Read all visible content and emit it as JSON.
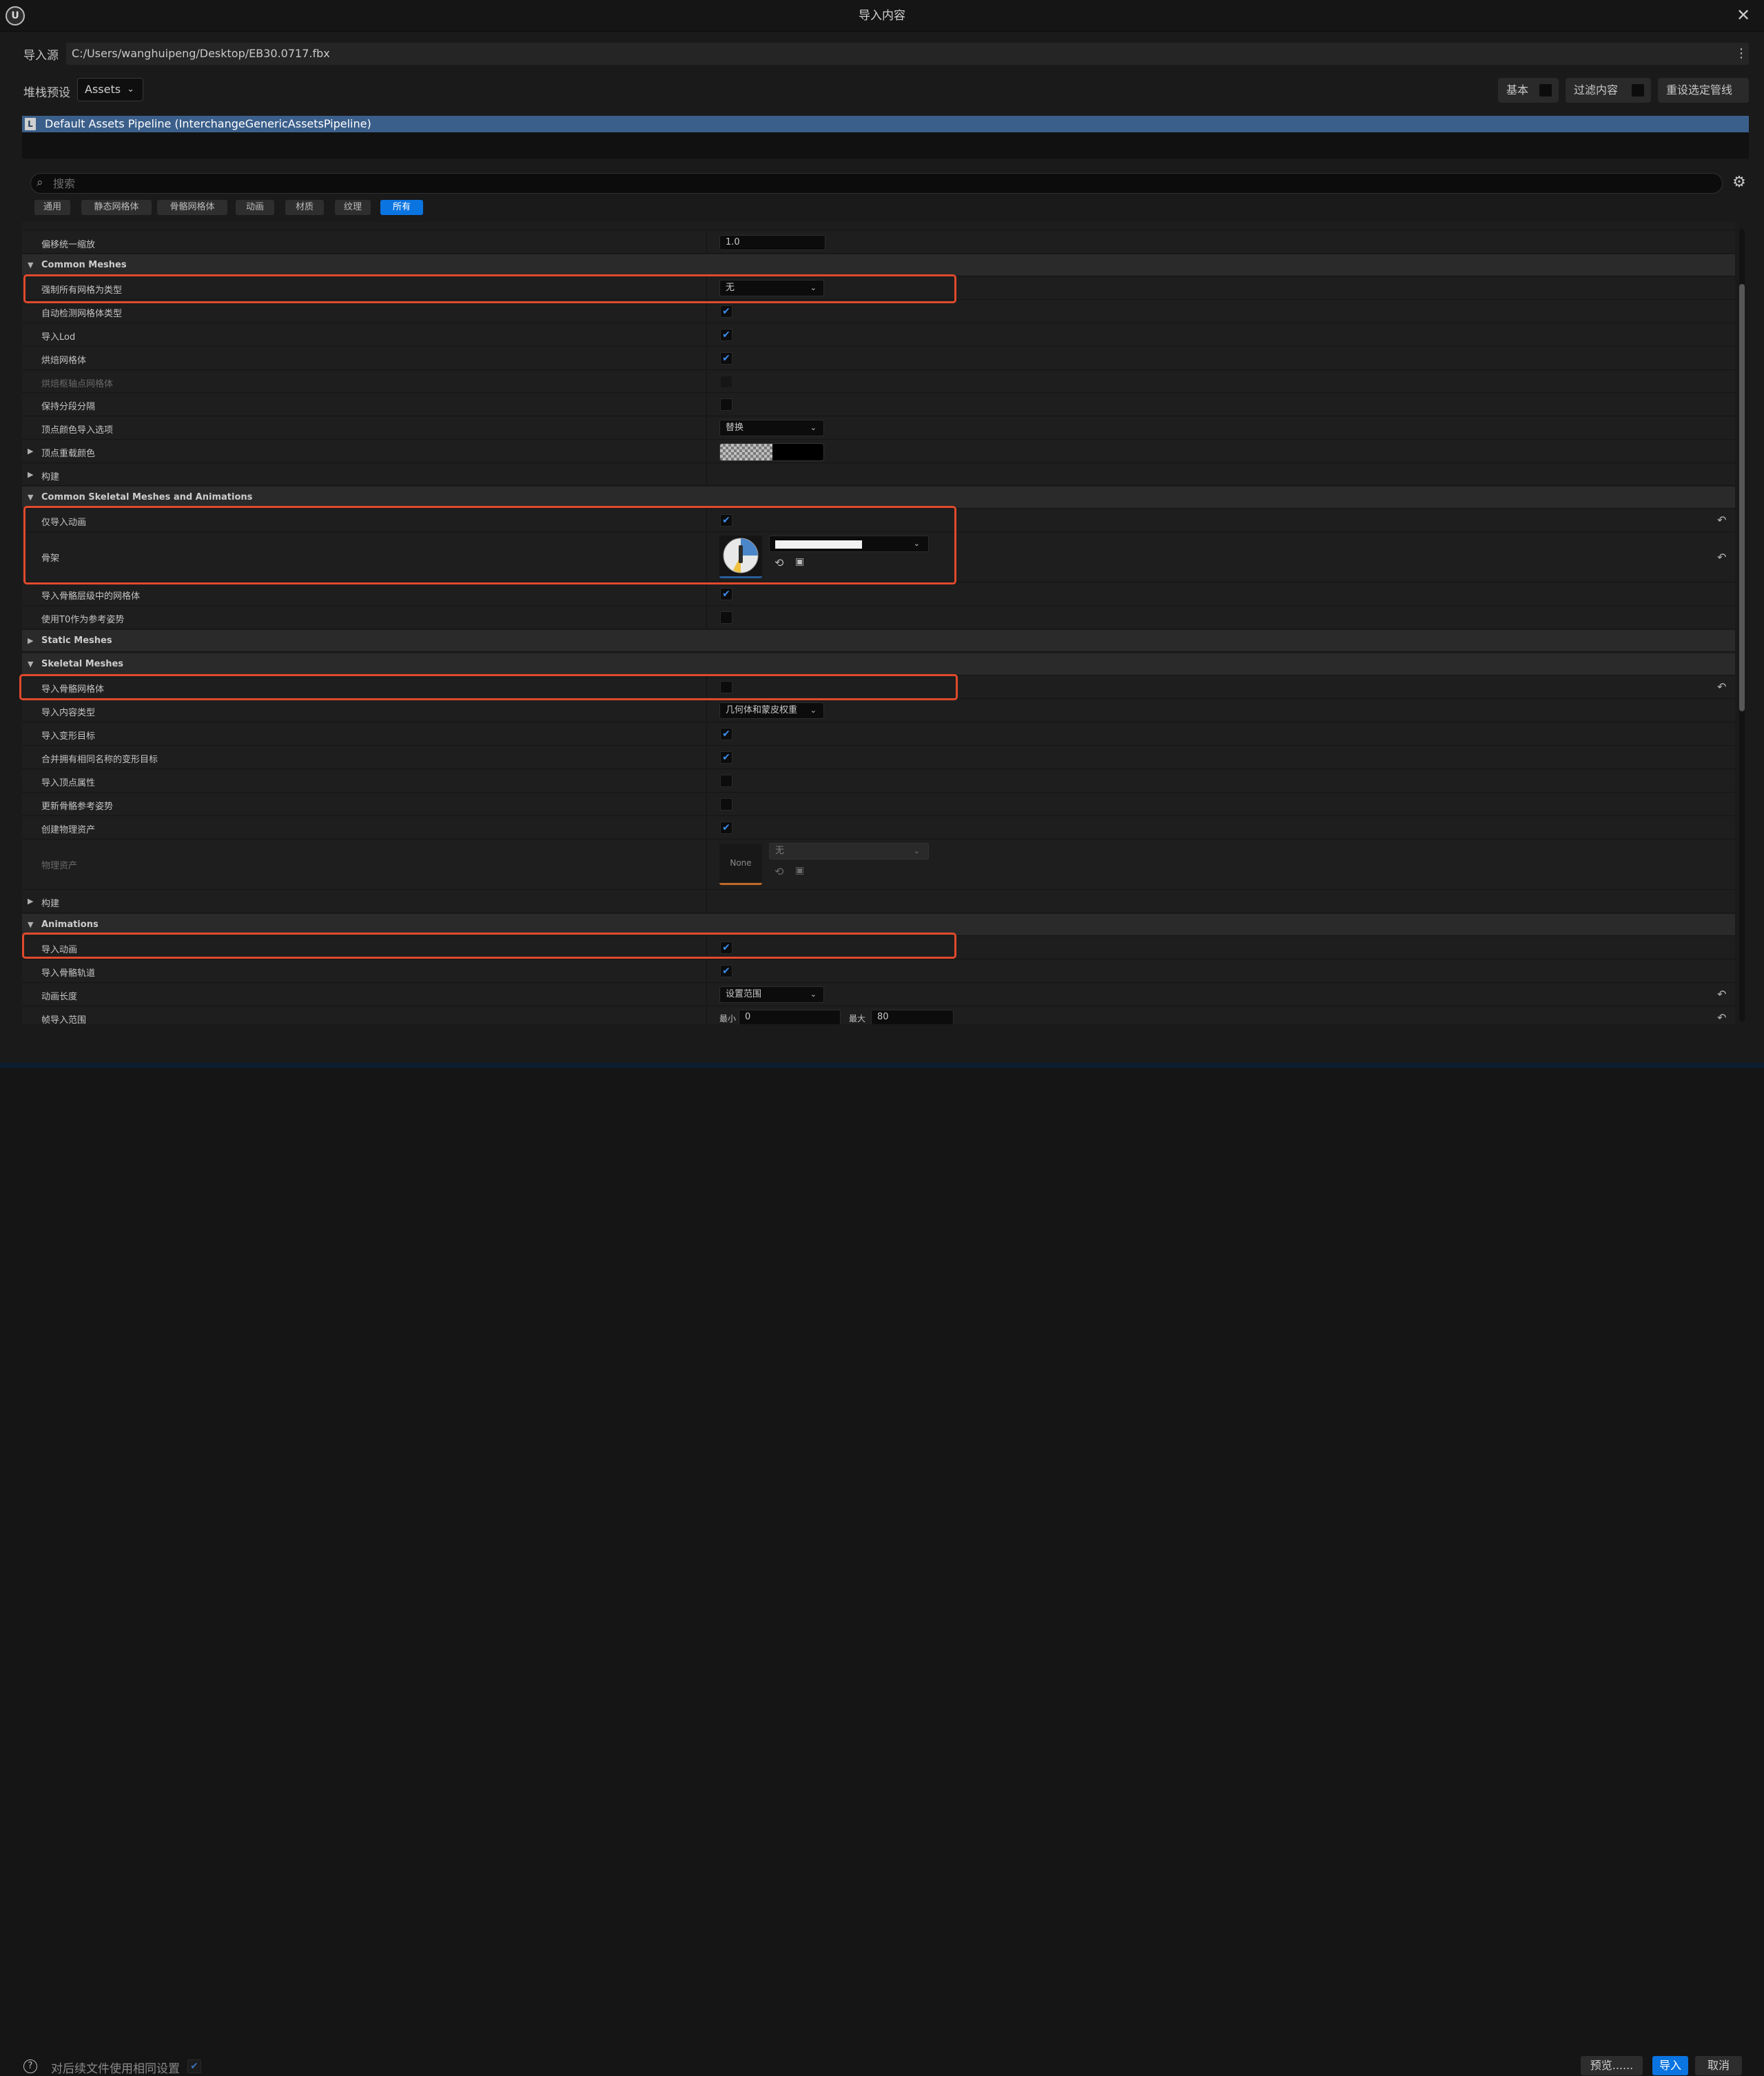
{
  "window": {
    "title": "导入内容",
    "close_icon": "✕"
  },
  "source": {
    "label": "导入源",
    "path": "C:/Users/wanghuipeng/Desktop/EB30.0717.fbx"
  },
  "stack": {
    "label": "堆栈预设",
    "value": "Assets"
  },
  "toolbar": {
    "basic_label": "基本",
    "filter_label": "过滤内容",
    "reset_label": "重设选定管线"
  },
  "pipeline": {
    "name": "Default Assets Pipeline (InterchangeGenericAssetsPipeline)"
  },
  "search": {
    "placeholder": "搜索"
  },
  "filter_tabs": [
    {
      "label": "通用"
    },
    {
      "label": "静态网格体"
    },
    {
      "label": "骨骼网格体"
    },
    {
      "label": "动画"
    },
    {
      "label": "材质"
    },
    {
      "label": "纹理"
    },
    {
      "label": "所有",
      "active": true
    }
  ],
  "props": {
    "offset_uniform_scale": {
      "label": "偏移统一缩放",
      "value": "1.0"
    },
    "common_meshes": {
      "label": "Common Meshes"
    },
    "force_all_mesh_type": {
      "label": "强制所有网格为类型",
      "value": "无"
    },
    "auto_detect_mesh_type": {
      "label": "自动检测网格体类型",
      "checked": true
    },
    "import_lods": {
      "label": "导入Lod",
      "checked": true
    },
    "bake_meshes": {
      "label": "烘焙网格体",
      "checked": true
    },
    "bake_pivot_meshes": {
      "label": "烘焙枢轴点网格体",
      "checked": false,
      "disabled": true
    },
    "keep_sections_separate": {
      "label": "保持分段分隔",
      "checked": false
    },
    "vertex_color_import_option": {
      "label": "顶点颜色导入选项",
      "value": "替换"
    },
    "vertex_override_color": {
      "label": "顶点重载颜色"
    },
    "build_1": {
      "label": "构建"
    },
    "common_skeletal": {
      "label": "Common Skeletal Meshes and Animations"
    },
    "import_only_animations": {
      "label": "仅导入动画",
      "checked": true
    },
    "skeleton": {
      "label": "骨架"
    },
    "import_meshes_in_bone_hierarchy": {
      "label": "导入骨骼层级中的网格体",
      "checked": true
    },
    "use_t0_as_ref_pose": {
      "label": "使用T0作为参考姿势",
      "checked": false
    },
    "static_meshes": {
      "label": "Static Meshes"
    },
    "skeletal_meshes": {
      "label": "Skeletal Meshes"
    },
    "import_skeletal_meshes": {
      "label": "导入骨骼网格体",
      "checked": false
    },
    "import_content_type": {
      "label": "导入内容类型",
      "value": "几何体和蒙皮权重"
    },
    "import_morph_targets": {
      "label": "导入变形目标",
      "checked": true
    },
    "merge_morph_targets": {
      "label": "合并拥有相同名称的变形目标",
      "checked": true
    },
    "import_vertex_attributes": {
      "label": "导入顶点属性",
      "checked": false
    },
    "update_skeleton_ref_pose": {
      "label": "更新骨骼参考姿势",
      "checked": false
    },
    "create_physics_asset": {
      "label": "创建物理资产",
      "checked": true
    },
    "physics_asset": {
      "label": "物理资产",
      "thumb_text": "None",
      "value": "无"
    },
    "build_2": {
      "label": "构建"
    },
    "animations": {
      "label": "Animations"
    },
    "import_animations": {
      "label": "导入动画",
      "checked": true
    },
    "import_bone_tracks": {
      "label": "导入骨骼轨道",
      "checked": true
    },
    "animation_length": {
      "label": "动画长度",
      "value": "设置范围"
    },
    "frame_import_range": {
      "label": "帧导入范围",
      "min_label": "最小",
      "min": "0",
      "max_label": "最大",
      "max": "80"
    }
  },
  "footer": {
    "use_same_settings_label": "对后续文件使用相同设置",
    "use_same_checked": true,
    "preview_label": "预览......",
    "import_label": "导入",
    "cancel_label": "取消"
  },
  "colors": {
    "accent": "#0a74e0",
    "highlight": "#e04a2c",
    "pipeline_bar": "#3b5f8b",
    "check": "#3d8ef0"
  },
  "glyphs": {
    "check": "✔",
    "chevron": "⌄",
    "tri_open": "▼",
    "tri_closed": "▶",
    "reset": "↶",
    "kebab": "⋮",
    "search": "⌕",
    "gear": "⚙",
    "help": "?"
  }
}
